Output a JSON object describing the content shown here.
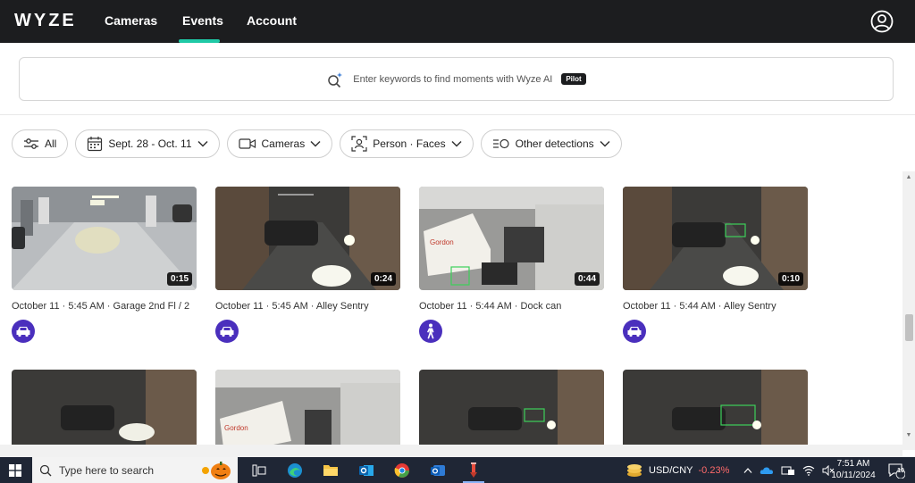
{
  "nav": {
    "logo": "WYZE",
    "links": [
      "Cameras",
      "Events",
      "Account"
    ],
    "active": "Events"
  },
  "search": {
    "placeholder": "Enter keywords to find moments with Wyze AI",
    "badge": "Pilot"
  },
  "filters": [
    {
      "label": "All",
      "icon": "sliders-icon"
    },
    {
      "label": "Sept. 28 - Oct. 11",
      "icon": "calendar-icon"
    },
    {
      "label": "Cameras",
      "icon": "camera-icon"
    },
    {
      "label": "Person · Faces",
      "icon": "person-frame-icon"
    },
    {
      "label": "Other detections",
      "icon": "detections-icon"
    }
  ],
  "events": [
    {
      "title": "October 11 · 5:45 AM · Garage 2nd Fl / 2",
      "duration": "0:15",
      "type": "vehicle-icon",
      "scene": "garage"
    },
    {
      "title": "October 11 · 5:45 AM · Alley Sentry",
      "duration": "0:24",
      "type": "vehicle-icon",
      "scene": "alley"
    },
    {
      "title": "October 11 · 5:44 AM · Dock can",
      "duration": "0:44",
      "type": "person-icon",
      "scene": "dock"
    },
    {
      "title": "October 11 · 5:44 AM · Alley Sentry",
      "duration": "0:10",
      "type": "vehicle-icon",
      "scene": "alley"
    },
    {
      "title": "",
      "duration": "",
      "type": "",
      "scene": "alley"
    },
    {
      "title": "",
      "duration": "",
      "type": "",
      "scene": "dock"
    },
    {
      "title": "",
      "duration": "",
      "type": "",
      "scene": "alley"
    },
    {
      "title": "",
      "duration": "",
      "type": "",
      "scene": "alley"
    }
  ],
  "taskbar": {
    "search_placeholder": "Type here to search",
    "stock_label": "USD/CNY",
    "stock_change": "-0.23%",
    "time": "7:51 AM",
    "date": "10/11/2024",
    "notifications": "10"
  },
  "colors": {
    "nav_bg": "#1c1d1f",
    "accent": "#1fc9a6",
    "event_icon": "#4a2fbd"
  }
}
